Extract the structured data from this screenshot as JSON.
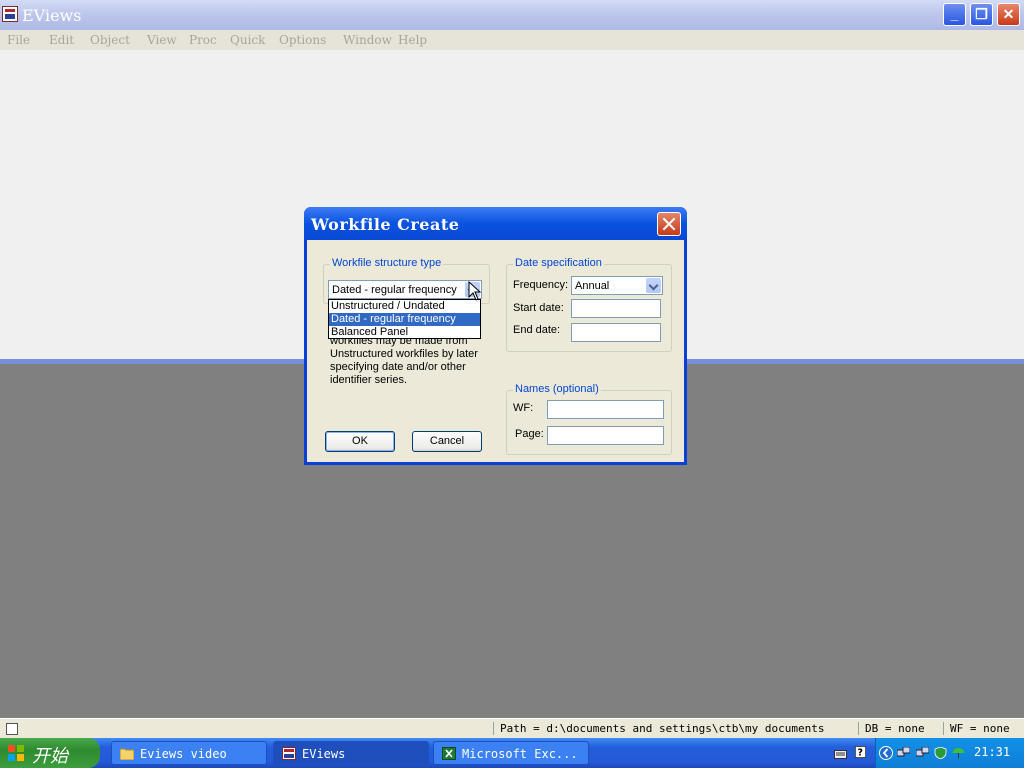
{
  "app": {
    "title": "EViews",
    "icon": "eviews-app-icon"
  },
  "menu": [
    "File",
    "Edit",
    "Object",
    "View",
    "Proc",
    "Quick",
    "Options",
    "Window",
    "Help"
  ],
  "status": {
    "path": "Path = d:\\documents and settings\\ctb\\my documents",
    "db": "DB = none",
    "wf": "WF = none"
  },
  "taskbar": {
    "start_label": "开始",
    "tasks": [
      {
        "label": "Eviews video",
        "icon": "folder-icon",
        "active": false
      },
      {
        "label": "EViews",
        "icon": "eviews-app-icon",
        "active": true
      },
      {
        "label": "Microsoft Exc...",
        "icon": "excel-icon",
        "active": false
      }
    ],
    "clock": "21:31"
  },
  "dialog": {
    "title": "Workfile Create",
    "structure": {
      "legend": "Workfile structure type",
      "selected": "Dated - regular frequency",
      "options": [
        "Unstructured / Undated",
        "Dated - regular frequency",
        "Balanced Panel"
      ],
      "highlighted_index": 1,
      "description": [
        "workfiles may be made from",
        "Unstructured workfiles by later",
        "specifying date and/or other",
        "identifier series."
      ]
    },
    "date_spec": {
      "legend": "Date specification",
      "frequency_label": "Frequency:",
      "frequency_value": "Annual",
      "start_label": "Start date:",
      "start_value": "",
      "end_label": "End date:",
      "end_value": ""
    },
    "names": {
      "legend": "Names (optional)",
      "wf_label": "WF:",
      "wf_value": "",
      "page_label": "Page:",
      "page_value": ""
    },
    "ok_label": "OK",
    "cancel_label": "Cancel"
  },
  "colors": {
    "xp_blue": "#0a52e0",
    "legend_blue": "#0046d5",
    "highlight": "#316ac5"
  }
}
